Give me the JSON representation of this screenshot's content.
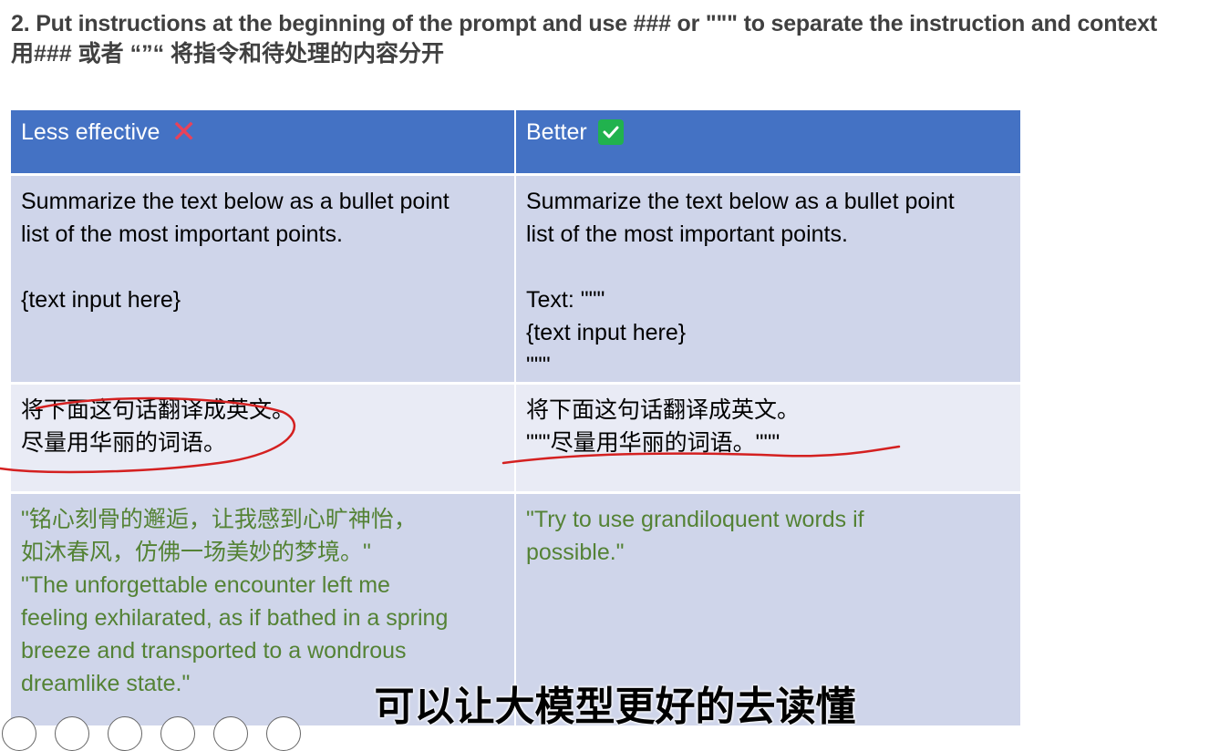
{
  "heading": {
    "line1": "2. Put instructions at the beginning of the prompt and use ### or \"\"\" to separate the instruction and context",
    "line2": "用### 或者 “”“ 将指令和待处理的内容分开"
  },
  "table": {
    "header_left": "Less effective",
    "header_right": "Better",
    "row1_left_line1": "Summarize the text below as a bullet point",
    "row1_left_line2": "list of the most important points.",
    "row1_left_line3": "{text input here}",
    "row1_right_line1": "Summarize the text below as a bullet point",
    "row1_right_line2": "list of the most important points.",
    "row1_right_line3": "Text: \"\"\"",
    "row1_right_line4": "{text input here}",
    "row1_right_line5": "\"\"\"",
    "row2_left_line1": "将下面这句话翻译成英文。",
    "row2_left_line2": "尽量用华丽的词语。",
    "row2_right_line1": "将下面这句话翻译成英文。",
    "row2_right_line2": "\"\"\"尽量用华丽的词语。\"\"\"",
    "row3_left_line1": "\"铭心刻骨的邂逅，让我感到心旷神怡，",
    "row3_left_line2": "如沐春风，仿佛一场美妙的梦境。\"",
    "row3_left_line3": "\"The unforgettable encounter left me",
    "row3_left_line4": "feeling exhilarated, as if bathed in a spring",
    "row3_left_line5": "breeze and transported to a wondrous",
    "row3_left_line6": "dreamlike state.\"",
    "row3_right_line1": "\"Try to use grandiloquent words if",
    "row3_right_line2": "possible.\""
  },
  "subtitle": "可以让大模型更好的去读懂",
  "icons": {
    "less_effective": "cross-mark-icon",
    "better": "check-mark-icon"
  },
  "colors": {
    "header": "#4472c4",
    "row_dark": "#cfd5ea",
    "row_light": "#e9ebf5",
    "green_text": "#548235",
    "annotation_red": "#d42020",
    "cross": "#e8425a",
    "check": "#21b24e"
  }
}
